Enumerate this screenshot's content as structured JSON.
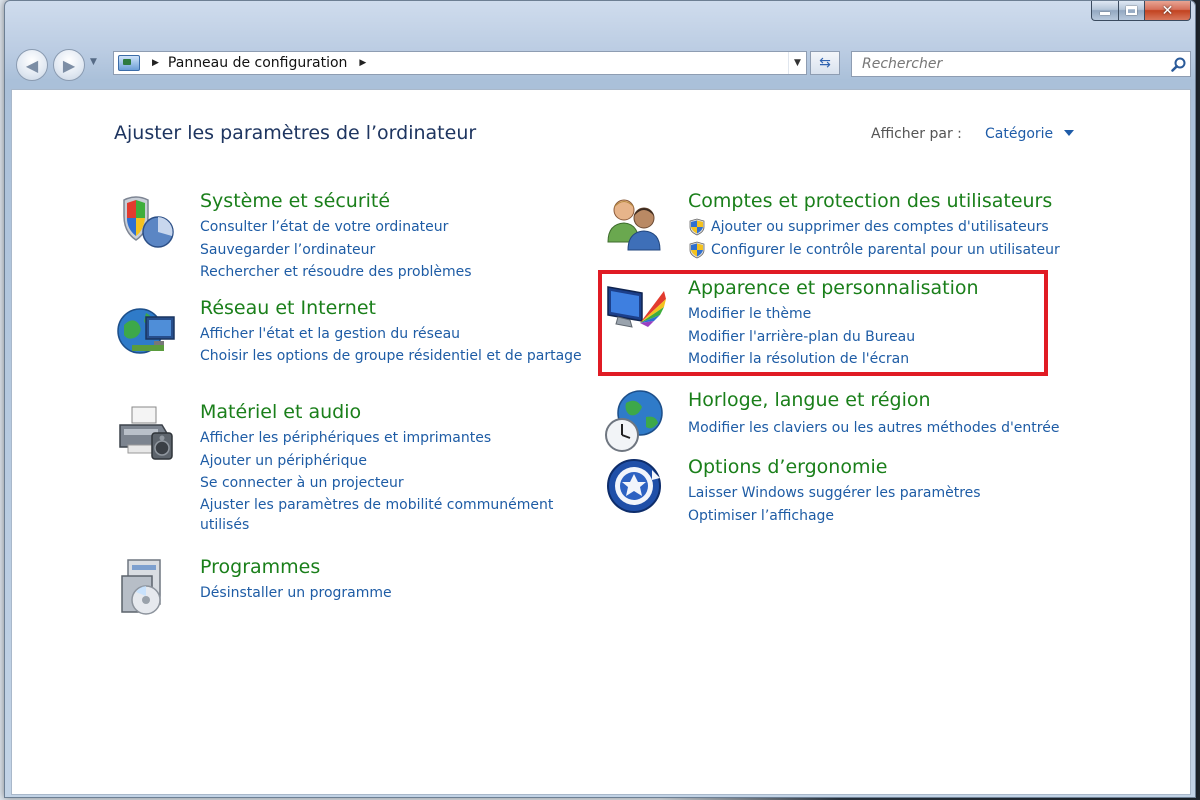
{
  "window": {
    "controls": {
      "close_glyph": "✕"
    }
  },
  "address_bar": {
    "crumb": "Panneau de configuration"
  },
  "search": {
    "placeholder": "Rechercher"
  },
  "header": {
    "title": "Ajuster les paramètres de l’ordinateur",
    "view_by_label": "Afficher par :",
    "view_by_value": "Catégorie"
  },
  "categories": {
    "system": {
      "title": "Système et sécurité",
      "links": [
        "Consulter l’état de votre ordinateur",
        "Sauvegarder l’ordinateur",
        "Rechercher et résoudre des problèmes"
      ]
    },
    "network": {
      "title": "Réseau et Internet",
      "links": [
        "Afficher l'état et la gestion du réseau",
        "Choisir les options de groupe résidentiel et de partage"
      ]
    },
    "hardware": {
      "title": "Matériel et audio",
      "links": [
        "Afficher les périphériques et imprimantes",
        "Ajouter un périphérique",
        "Se connecter à un projecteur",
        "Ajuster les paramètres de mobilité communément utilisés"
      ]
    },
    "programs": {
      "title": "Programmes",
      "links": [
        "Désinstaller un programme"
      ]
    },
    "accounts": {
      "title": "Comptes et protection des utilisateurs",
      "links": [
        "Ajouter ou supprimer des comptes d'utilisateurs",
        "Configurer le contrôle parental pour un utilisateur"
      ]
    },
    "appearance": {
      "title": "Apparence et personnalisation",
      "links": [
        "Modifier le thème",
        "Modifier l'arrière-plan du Bureau",
        "Modifier la résolution de l'écran"
      ]
    },
    "clock": {
      "title": "Horloge, langue et région",
      "links": [
        "Modifier les claviers ou les autres méthodes d'entrée"
      ]
    },
    "ease": {
      "title": "Options d’ergonomie",
      "links": [
        "Laisser Windows suggérer les paramètres",
        "Optimiser l’affichage"
      ]
    }
  },
  "colors": {
    "category_title": "#1a7f1a",
    "link": "#1e5ca5",
    "highlight_box": "#e01b24"
  }
}
